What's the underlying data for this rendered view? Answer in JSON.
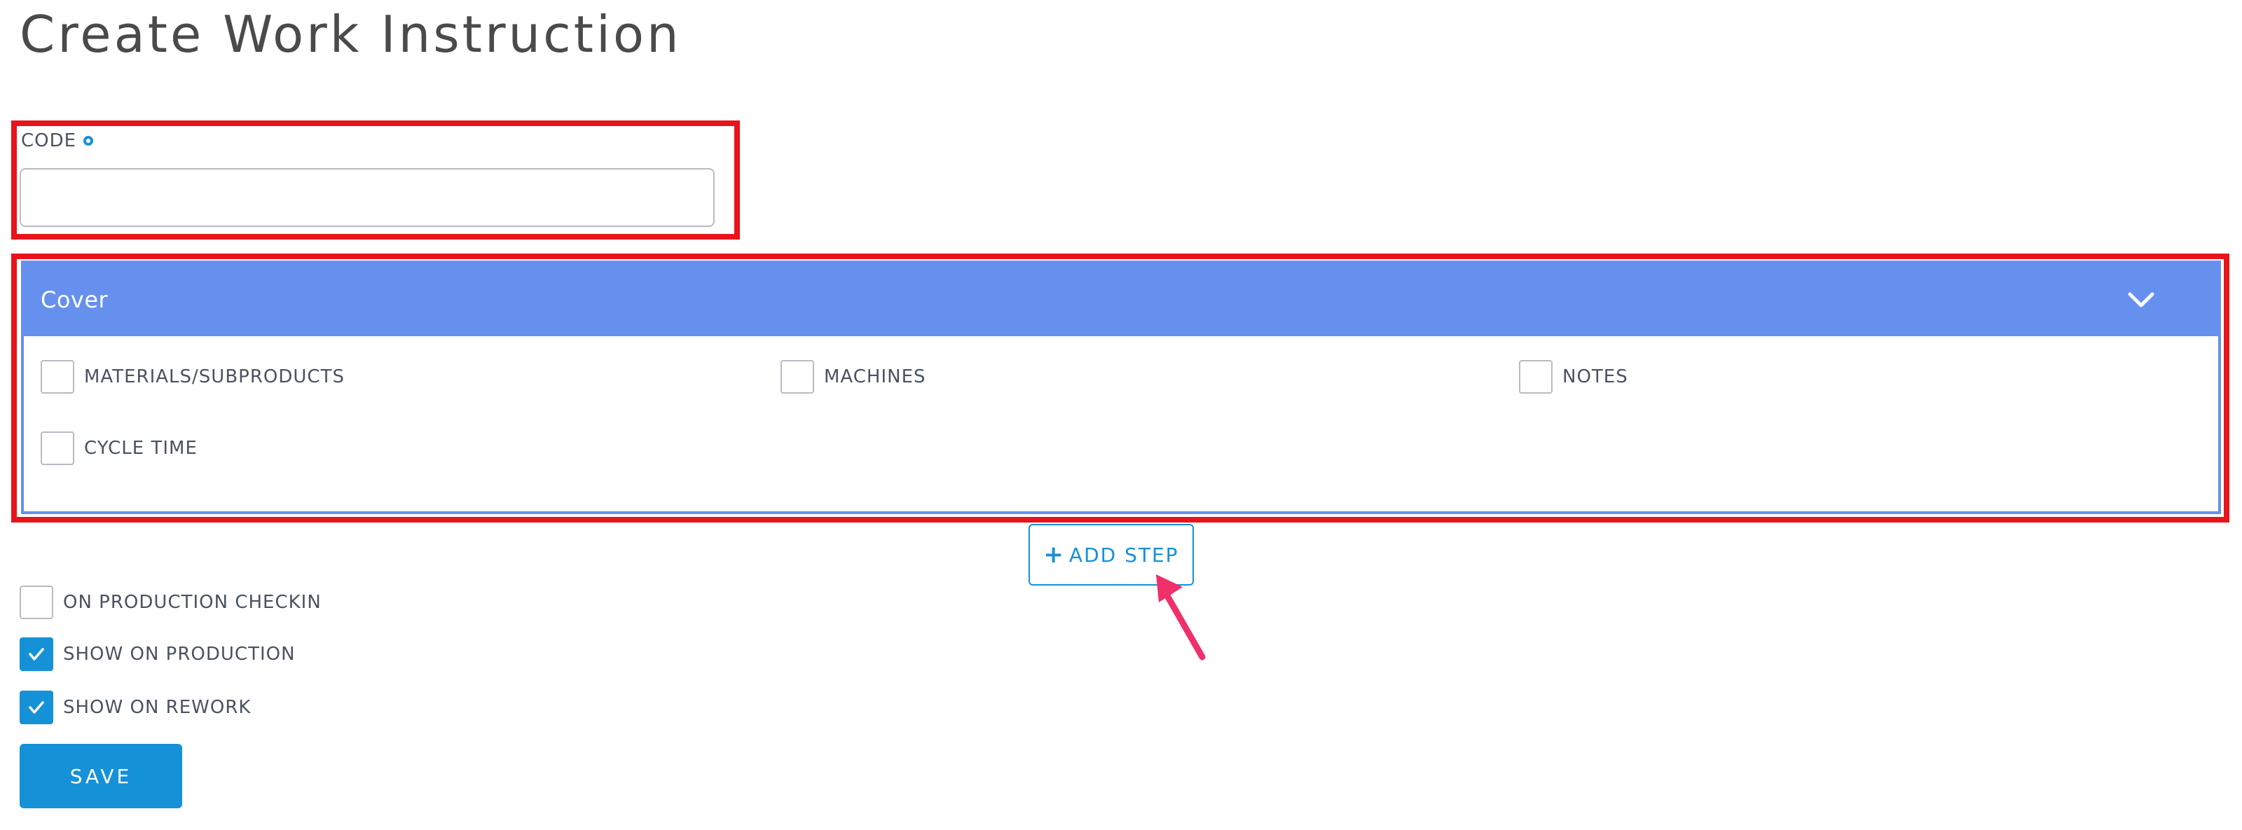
{
  "page": {
    "title": "Create Work Instruction"
  },
  "code_field": {
    "label": "CODE",
    "value": "",
    "placeholder": ""
  },
  "cover": {
    "title": "Cover",
    "options": {
      "materials": {
        "label": "MATERIALS/SUBPRODUCTS",
        "checked": false
      },
      "machines": {
        "label": "MACHINES",
        "checked": false
      },
      "notes": {
        "label": "NOTES",
        "checked": false
      },
      "cycle_time": {
        "label": "CYCLE TIME",
        "checked": false
      }
    }
  },
  "add_step": {
    "icon": "plus-icon",
    "label": "ADD STEP"
  },
  "settings": {
    "on_production_checkin": {
      "label": "ON PRODUCTION CHECKIN",
      "checked": false
    },
    "show_on_production": {
      "label": "SHOW ON PRODUCTION",
      "checked": true
    },
    "show_on_rework": {
      "label": "SHOW ON REWORK",
      "checked": true
    }
  },
  "save": {
    "label": "SAVE"
  },
  "colors": {
    "accent": "#1591d8",
    "cover_header": "#6690ee",
    "highlight": "#e8141c",
    "arrow": "#f0306a"
  }
}
